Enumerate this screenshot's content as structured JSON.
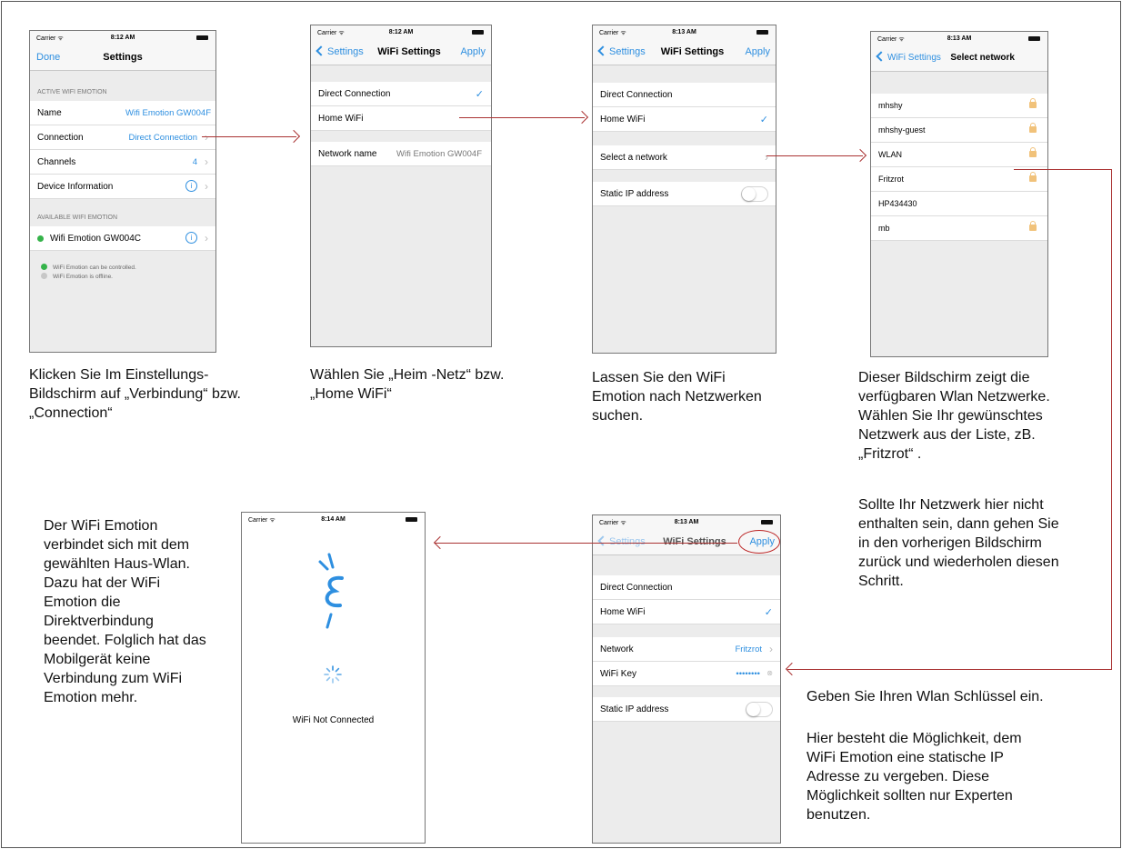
{
  "colors": {
    "accent": "#2e8fe0",
    "arrow": "#aa3333",
    "green": "#35b34a",
    "gray": "#c7c7c7"
  },
  "status": {
    "carrier": "Carrier ᯤ",
    "time1": "8:12 AM",
    "time2": "8:12 AM",
    "time3": "8:13 AM",
    "time4": "8:13 AM",
    "time5": "8:13 AM",
    "time6": "8:14 AM"
  },
  "screen1": {
    "nav_left": "Done",
    "nav_title": "Settings",
    "section_active": "ACTIVE WIFI EMOTION",
    "rows": [
      {
        "label": "Name",
        "value": "Wifi Emotion GW004F"
      },
      {
        "label": "Connection",
        "value": "Direct Connection"
      },
      {
        "label": "Channels",
        "value": "4"
      },
      {
        "label": "Device Information",
        "value": ""
      }
    ],
    "section_available": "AVAILABLE WIFI EMOTION",
    "available_device": "Wifi Emotion GW004C",
    "legend_online": "WiFi Emotion can be controlled.",
    "legend_offline": "WiFi Emotion is offline."
  },
  "screen2": {
    "nav_back": "Settings",
    "nav_title": "WiFi Settings",
    "nav_right": "Apply",
    "rows": [
      "Direct Connection",
      "Home WiFi"
    ],
    "network_name_label": "Network name",
    "network_name_value": "Wifi Emotion GW004F"
  },
  "screen3": {
    "nav_back": "Settings",
    "nav_title": "WiFi Settings",
    "nav_right": "Apply",
    "rows": [
      "Direct Connection",
      "Home WiFi"
    ],
    "select_network": "Select a network",
    "static_ip": "Static IP address"
  },
  "screen4": {
    "nav_back": "WiFi Settings",
    "nav_title": "Select network",
    "networks": [
      {
        "name": "mhshy",
        "locked": true
      },
      {
        "name": "mhshy-guest",
        "locked": true
      },
      {
        "name": "WLAN",
        "locked": true
      },
      {
        "name": "Fritzrot",
        "locked": true
      },
      {
        "name": "HP434430",
        "locked": false
      },
      {
        "name": "mb",
        "locked": true
      }
    ]
  },
  "screen5": {
    "nav_back": "Settings",
    "nav_title": "WiFi Settings",
    "nav_right": "Apply",
    "rows": [
      "Direct Connection",
      "Home WiFi"
    ],
    "network_label": "Network",
    "network_value": "Fritzrot",
    "wifi_key_label": "WiFi Key",
    "wifi_key_value": "••••••••",
    "static_ip": "Static IP address"
  },
  "screen6": {
    "status_text": "WiFi Not Connected"
  },
  "captions": {
    "c1": "Klicken Sie Im Einstellungs-Bildschirm auf „Verbindung“ bzw. „Connection“",
    "c2": "Wählen Sie „Heim -Netz“ bzw. „Home WiFi“",
    "c3": "Lassen Sie den WiFi Emotion nach Netzwerken suchen.",
    "c4": "Dieser Bildschirm zeigt die verfügbaren Wlan Netzwerke. Wählen Sie Ihr gewünschtes Netzwerk aus der Liste, zB. „Fritzrot“ .",
    "c4b": "Sollte Ihr Netzwerk hier nicht enthalten sein, dann gehen Sie in den vorherigen Bildschirm zurück und wiederholen diesen Schritt.",
    "c5": "Geben Sie Ihren Wlan Schlüssel ein.",
    "c5b": "Hier besteht die Möglichkeit, dem WiFi Emotion eine statische IP Adresse zu vergeben. Diese Möglichkeit sollten nur Experten benutzen.",
    "c6": "Der WiFi Emotion verbindet sich mit dem gewählten Haus-Wlan. Dazu hat der WiFi Emotion die Direktverbindung beendet. Folglich hat das Mobilgerät keine Verbindung zum WiFi Emotion mehr."
  }
}
